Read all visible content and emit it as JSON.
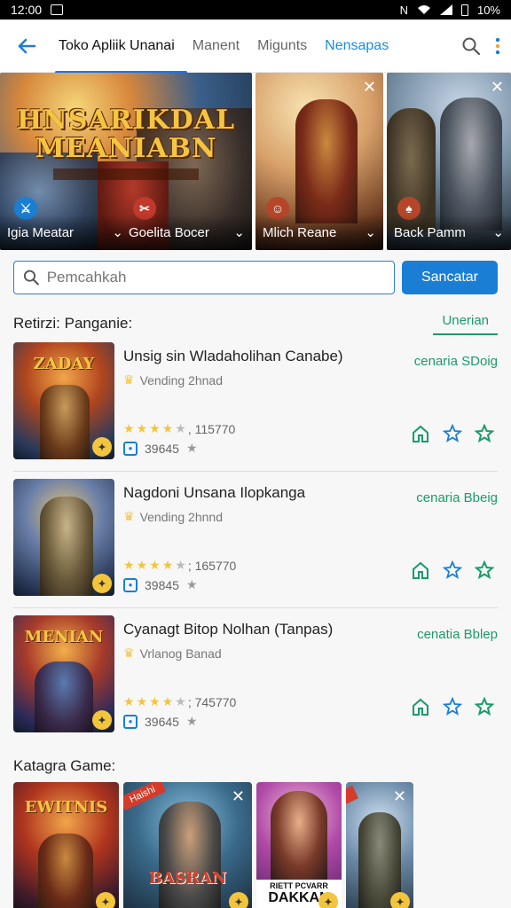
{
  "status_bar": {
    "time": "12:00",
    "battery": "10%"
  },
  "header": {
    "tabs": [
      {
        "label": "Toko Apliik Unanai"
      },
      {
        "label": "Manent"
      },
      {
        "label": "Migunts"
      },
      {
        "label": "Nensapas"
      }
    ]
  },
  "hero": {
    "cards": [
      {
        "label": "Igia Meatar",
        "title_line1": "HNSARIKDAL",
        "title_line2": "MEANIABN"
      },
      {
        "label": "Goelita Bocer"
      },
      {
        "label": "Mlich Reane"
      },
      {
        "label": "Back Pamm"
      }
    ]
  },
  "search": {
    "placeholder": "Pemcahkah",
    "button_label": "Sancatar"
  },
  "section": {
    "title": "Retirzi: Panganie:",
    "link": "Unerian"
  },
  "items": [
    {
      "title": "Unsig sin Wladaholihan Canabe)",
      "developer": "Vending 2hnad",
      "rating": 4.5,
      "ratings_text": ", 115770",
      "downloads": "39645",
      "side_text": "cenaria SDoig",
      "thumb_title": "ZADAY"
    },
    {
      "title": "Nagdoni Unsana Ilopkanga",
      "developer": "Vending 2hnnd",
      "rating": 4.5,
      "ratings_text": "; 165770",
      "downloads": "39845",
      "side_text": "cenaria Bbeig",
      "thumb_title": ""
    },
    {
      "title": "Cyanagt Bitop Nolhan  (Tanpas)",
      "developer": "Vrlanog Banad",
      "rating": 4.5,
      "ratings_text": "; 745770",
      "downloads": "39645",
      "side_text": "cenatia Bblep",
      "thumb_title": "MENIAN"
    }
  ],
  "categories": {
    "title": "Katagra Game:",
    "cards": [
      {
        "title": "EWITNIS"
      },
      {
        "title": "BASRAN",
        "ribbon": "Haishi"
      },
      {
        "title_line1": "RIETT PCVARR",
        "title_line2": "DAKKAN"
      },
      {
        "title": ""
      }
    ]
  },
  "colors": {
    "accent": "#1a7fd4",
    "green": "#1b9b6a",
    "gold": "#f2c53d"
  }
}
